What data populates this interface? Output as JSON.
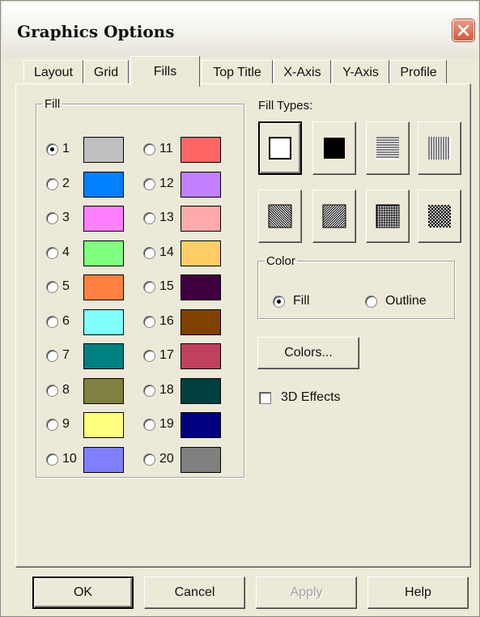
{
  "window": {
    "title": "Graphics Options"
  },
  "tabs": [
    {
      "label": "Layout"
    },
    {
      "label": "Grid"
    },
    {
      "label": "Fills"
    },
    {
      "label": "Top Title"
    },
    {
      "label": "X-Axis"
    },
    {
      "label": "Y-Axis"
    },
    {
      "label": "Profile"
    }
  ],
  "active_tab": "Fills",
  "fill_group": {
    "legend": "Fill",
    "selected": "1",
    "items": [
      {
        "label": "1",
        "color": "#c0c0c0"
      },
      {
        "label": "2",
        "color": "#0080ff"
      },
      {
        "label": "3",
        "color": "#ff80ff"
      },
      {
        "label": "4",
        "color": "#80ff80"
      },
      {
        "label": "5",
        "color": "#ff8040"
      },
      {
        "label": "6",
        "color": "#80ffff"
      },
      {
        "label": "7",
        "color": "#008080"
      },
      {
        "label": "8",
        "color": "#808040"
      },
      {
        "label": "9",
        "color": "#ffff80"
      },
      {
        "label": "10",
        "color": "#8080ff"
      },
      {
        "label": "11",
        "color": "#ff6666"
      },
      {
        "label": "12",
        "color": "#c080ff"
      },
      {
        "label": "13",
        "color": "#ffaaaa"
      },
      {
        "label": "14",
        "color": "#ffcc66"
      },
      {
        "label": "15",
        "color": "#400040"
      },
      {
        "label": "16",
        "color": "#804000"
      },
      {
        "label": "17",
        "color": "#c04060"
      },
      {
        "label": "18",
        "color": "#004040"
      },
      {
        "label": "19",
        "color": "#000080"
      },
      {
        "label": "20",
        "color": "#808080"
      }
    ]
  },
  "fill_types": {
    "label": "Fill Types:",
    "selected": "hollow",
    "items": [
      {
        "pattern": "hollow"
      },
      {
        "pattern": "solid"
      },
      {
        "pattern": "horizontal-lines"
      },
      {
        "pattern": "vertical-lines"
      },
      {
        "pattern": "backward-diagonal"
      },
      {
        "pattern": "forward-diagonal"
      },
      {
        "pattern": "cross-hatch"
      },
      {
        "pattern": "diagonal-cross"
      }
    ]
  },
  "color_group": {
    "legend": "Color",
    "selected": "Fill",
    "options": [
      {
        "label": "Fill"
      },
      {
        "label": "Outline"
      }
    ]
  },
  "colors_button": {
    "label": "Colors..."
  },
  "effects_checkbox": {
    "label": "3D Effects",
    "checked": false
  },
  "footer": {
    "ok": "OK",
    "cancel": "Cancel",
    "apply": "Apply",
    "help": "Help"
  }
}
